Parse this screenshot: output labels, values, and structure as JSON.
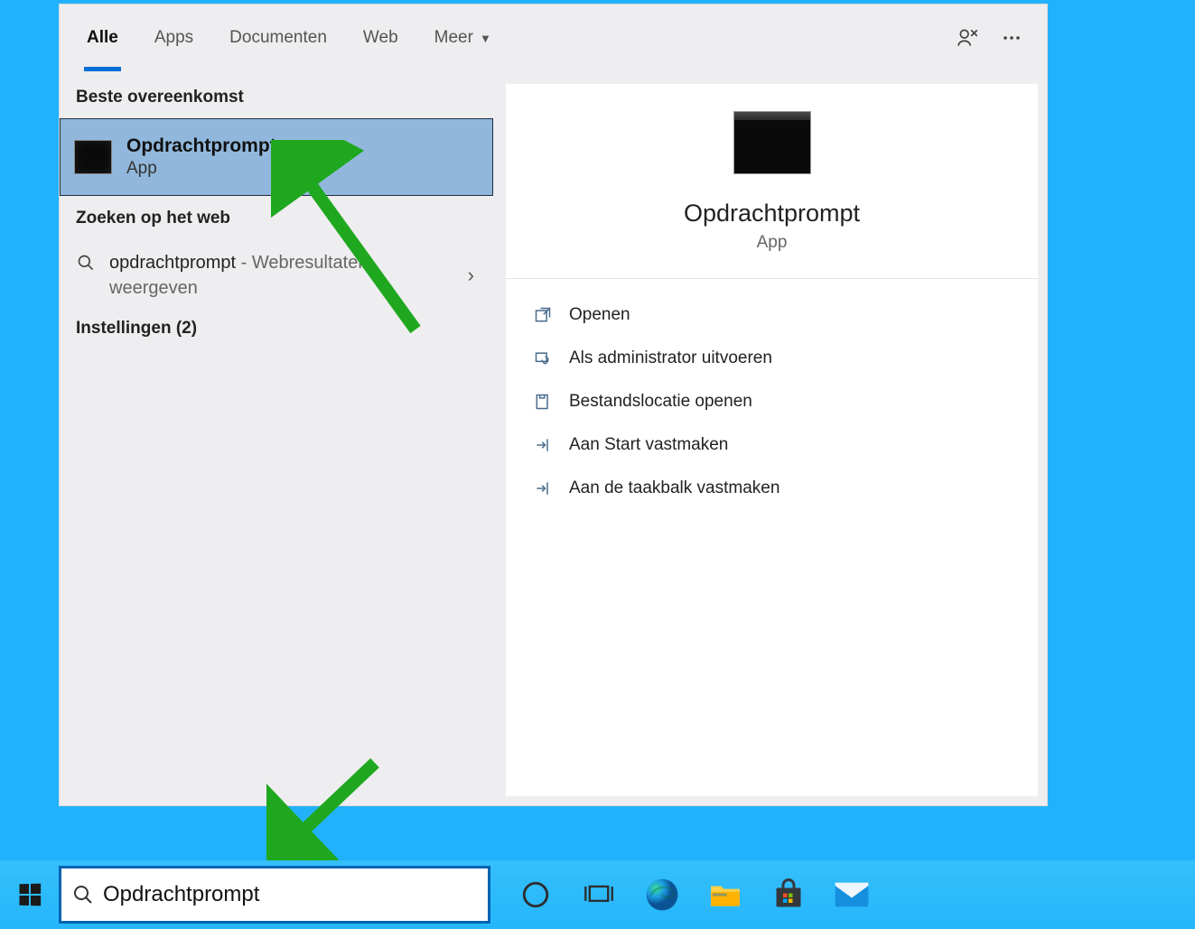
{
  "tabs": {
    "all": "Alle",
    "apps": "Apps",
    "docs": "Documenten",
    "web": "Web",
    "more": "Meer"
  },
  "left": {
    "best_match_label": "Beste overeenkomst",
    "best_match": {
      "title": "Opdrachtprompt",
      "subtitle": "App"
    },
    "web_label": "Zoeken op het web",
    "web_result": {
      "term": "opdrachtprompt",
      "suffix": " - Webresultaten weergeven"
    },
    "settings_label": "Instellingen (2)"
  },
  "right": {
    "title": "Opdrachtprompt",
    "subtitle": "App",
    "actions": {
      "open": "Openen",
      "admin": "Als administrator uitvoeren",
      "location": "Bestandslocatie openen",
      "pin_start": "Aan Start vastmaken",
      "pin_taskbar": "Aan de taakbalk vastmaken"
    }
  },
  "search": {
    "value": "Opdrachtprompt"
  }
}
